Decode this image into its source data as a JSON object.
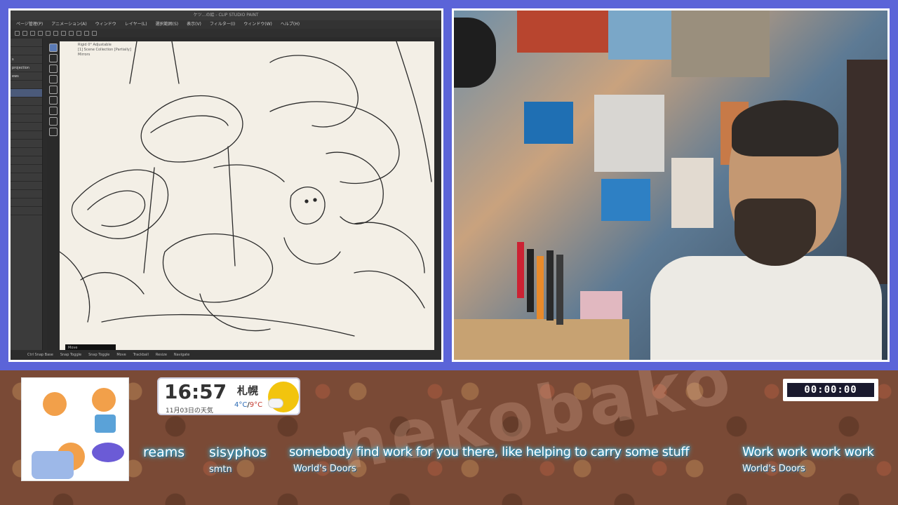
{
  "app": {
    "title": "ケツ…の絵 - CLIP STUDIO PAINT",
    "menu": [
      "ページ管理(P)",
      "アニメーション(A)",
      "ウィンドウ",
      "レイヤー(L)",
      "選択範囲(S)",
      "表示(V)",
      "フィルター(I)",
      "ウィンドウ(W)",
      "ヘルプ(H)"
    ],
    "layers": [
      "",
      "",
      "s",
      "projection",
      "ews",
      "",
      "",
      "",
      "",
      "",
      "",
      "",
      "",
      "",
      "",
      "",
      "",
      "",
      "",
      "",
      ""
    ],
    "canvas_info": [
      "Rigid 0° Adjustable",
      "[1] Scene Collection [Partially]",
      "Mirrors"
    ],
    "zoom": "Move",
    "status": [
      "Ctrl Snap Base",
      "Snap Toggle",
      "Snap Toggle",
      "Move",
      "Trackball",
      "Resize",
      "Navigate"
    ]
  },
  "clock": {
    "time": "16:57",
    "date": "11月03日の天気",
    "city": "札幌",
    "temp_hi": "4°C",
    "temp_sep": "/",
    "temp_lo": "9°C"
  },
  "timer": "00:00:00",
  "watermark": "nekobako",
  "tickers": [
    {
      "title": "reams",
      "subtitle": ""
    },
    {
      "title": "sisyphos",
      "subtitle": "smtn"
    },
    {
      "title": "somebody find work for you there, like helping to carry some stuff",
      "subtitle": "World's Doors"
    },
    {
      "title": "Work work work work",
      "subtitle": "World's Doors"
    }
  ],
  "colors": {
    "background": "#5b64d8",
    "bottom_bar": "#7a4a36",
    "ticker_glow": "#33ccff",
    "temp_hi": "#2b6bb4",
    "temp_lo": "#c43a2f"
  }
}
